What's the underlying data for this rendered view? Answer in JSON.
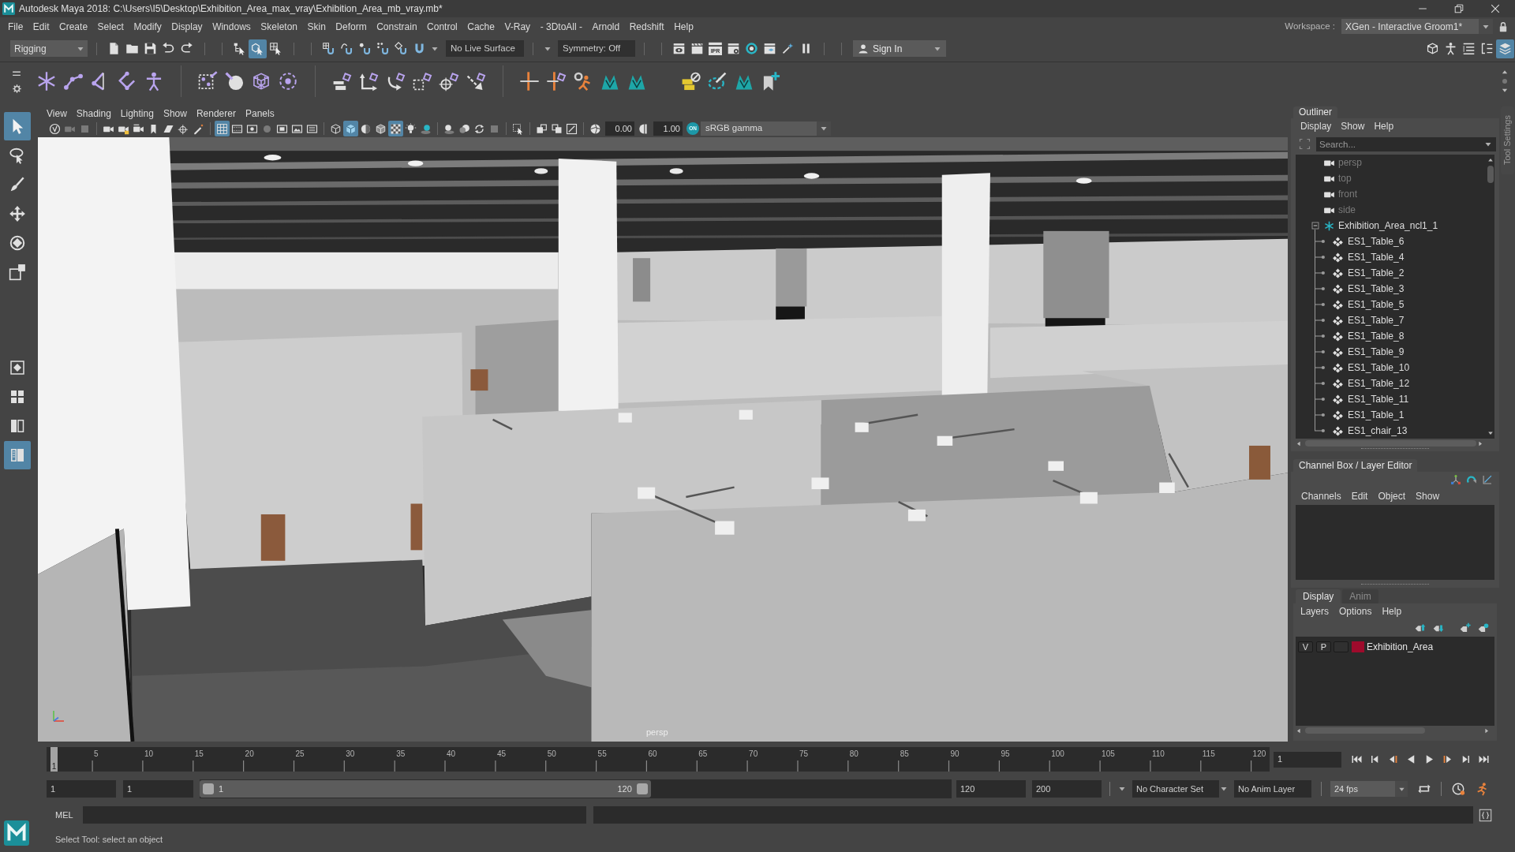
{
  "window": {
    "title": "Autodesk Maya 2018: C:\\Users\\I5\\Desktop\\Exhibition_Area_max_vray\\Exhibition_Area_mb_vray.mb*"
  },
  "menu_bar": [
    "File",
    "Edit",
    "Create",
    "Select",
    "Modify",
    "Display",
    "Windows",
    "Skeleton",
    "Skin",
    "Deform",
    "Constrain",
    "Control",
    "Cache",
    "V-Ray",
    "- 3DtoAll -",
    "Arnold",
    "Redshift",
    "Help"
  ],
  "workspace": {
    "label": "Workspace :",
    "value": "XGen - Interactive Groom1*"
  },
  "status_line": {
    "menu_set": "Rigging",
    "selection_buttons": [
      {
        "selected": false
      },
      {
        "selected": true
      },
      {
        "selected": false
      }
    ],
    "live_surface": "No Live Surface",
    "symmetry": "Symmetry: Off",
    "ipr_label": "IPR",
    "sign_in": "Sign In",
    "panel_buttons": [
      {
        "on": false
      },
      {
        "on": false
      },
      {
        "on": false
      },
      {
        "on": false
      },
      {
        "on": true
      }
    ]
  },
  "toolbox": {
    "tools": [
      {
        "selected": true
      },
      {
        "selected": false
      },
      {
        "selected": false
      },
      {
        "selected": false
      },
      {
        "selected": false
      },
      {
        "selected": false
      }
    ],
    "layouts": [
      {
        "selected": false
      },
      {
        "selected": false
      },
      {
        "selected": false
      },
      {
        "selected": true
      }
    ]
  },
  "viewport": {
    "menus": [
      "View",
      "Shading",
      "Lighting",
      "Show",
      "Renderer",
      "Panels"
    ],
    "toolbar_buttons": [
      {
        "on": false,
        "disabled": false
      },
      {
        "on": false,
        "disabled": true
      },
      {
        "on": false,
        "disabled": true
      },
      {
        "on": false,
        "disabled": false
      },
      {
        "on": false,
        "disabled": false
      },
      {
        "on": false,
        "disabled": false
      },
      {
        "on": false,
        "disabled": false
      },
      {
        "on": false,
        "disabled": false
      },
      {
        "on": false,
        "disabled": false
      },
      {
        "on": false,
        "disabled": false
      },
      {
        "on": true,
        "disabled": false
      },
      {
        "on": false,
        "disabled": false
      },
      {
        "on": false,
        "disabled": false
      },
      {
        "on": false,
        "disabled": true
      },
      {
        "on": false,
        "disabled": false
      },
      {
        "on": false,
        "disabled": false
      },
      {
        "on": false,
        "disabled": false
      },
      {
        "on": false,
        "disabled": false
      },
      {
        "on": true,
        "disabled": false
      },
      {
        "on": false,
        "disabled": false
      },
      {
        "on": false,
        "disabled": false
      },
      {
        "on": true,
        "disabled": false
      },
      {
        "on": false,
        "disabled": false
      },
      {
        "on": false,
        "disabled": false
      },
      {
        "on": false,
        "disabled": false
      },
      {
        "on": false,
        "disabled": false
      },
      {
        "on": false,
        "disabled": false
      },
      {
        "on": false,
        "disabled": true
      },
      {
        "on": false,
        "disabled": false
      },
      {
        "on": false,
        "disabled": false
      },
      {
        "on": false,
        "disabled": false
      },
      {
        "on": false,
        "disabled": false
      },
      {
        "on": false,
        "disabled": false
      },
      {
        "on": false,
        "disabled": false
      }
    ],
    "exposure": "0.00",
    "gamma": "1.00",
    "color_management": {
      "label": "ON",
      "on": true
    },
    "color_space": "sRGB gamma",
    "camera": "persp"
  },
  "outliner": {
    "title": "Outliner",
    "menus": [
      "Display",
      "Show",
      "Help"
    ],
    "search": {
      "placeholder": "Search..."
    },
    "items": [
      {
        "kind": "camera",
        "label": "persp",
        "dimmed": true,
        "selected": false
      },
      {
        "kind": "camera",
        "label": "top",
        "dimmed": true,
        "selected": false
      },
      {
        "kind": "camera",
        "label": "front",
        "dimmed": true,
        "selected": false
      },
      {
        "kind": "camera",
        "label": "side",
        "dimmed": true,
        "selected": false
      },
      {
        "kind": "group",
        "label": "Exhibition_Area_ncl1_1",
        "dimmed": false,
        "selected": false,
        "expanded": true,
        "children": [
          {
            "kind": "mesh",
            "label": "ES1_Table_6",
            "dimmed": false,
            "selected": false
          },
          {
            "kind": "mesh",
            "label": "ES1_Table_4",
            "dimmed": false,
            "selected": false
          },
          {
            "kind": "mesh",
            "label": "ES1_Table_2",
            "dimmed": false,
            "selected": false
          },
          {
            "kind": "mesh",
            "label": "ES1_Table_3",
            "dimmed": false,
            "selected": false
          },
          {
            "kind": "mesh",
            "label": "ES1_Table_5",
            "dimmed": false,
            "selected": false
          },
          {
            "kind": "mesh",
            "label": "ES1_Table_7",
            "dimmed": false,
            "selected": false
          },
          {
            "kind": "mesh",
            "label": "ES1_Table_8",
            "dimmed": false,
            "selected": false
          },
          {
            "kind": "mesh",
            "label": "ES1_Table_9",
            "dimmed": false,
            "selected": false
          },
          {
            "kind": "mesh",
            "label": "ES1_Table_10",
            "dimmed": false,
            "selected": false
          },
          {
            "kind": "mesh",
            "label": "ES1_Table_12",
            "dimmed": false,
            "selected": false
          },
          {
            "kind": "mesh",
            "label": "ES1_Table_11",
            "dimmed": false,
            "selected": false
          },
          {
            "kind": "mesh",
            "label": "ES1_Table_1",
            "dimmed": false,
            "selected": false
          },
          {
            "kind": "mesh",
            "label": "ES1_chair_13",
            "dimmed": false,
            "selected": false
          }
        ]
      }
    ]
  },
  "tool_settings_tab": "Tool Settings",
  "channel_box": {
    "title": "Channel Box / Layer Editor",
    "menus": [
      "Channels",
      "Edit",
      "Object",
      "Show"
    ]
  },
  "layer_editor": {
    "tabs": [
      {
        "label": "Display",
        "selected": true
      },
      {
        "label": "Anim",
        "selected": false
      }
    ],
    "menus": [
      "Layers",
      "Options",
      "Help"
    ],
    "layers": [
      {
        "visibility": "V",
        "playback": "P",
        "name": "Exhibition_Area",
        "color": "#9e0b2c"
      }
    ]
  },
  "time_slider": {
    "ticks": [
      "5",
      "10",
      "15",
      "20",
      "25",
      "30",
      "35",
      "40",
      "45",
      "50",
      "55",
      "60",
      "65",
      "70",
      "75",
      "80",
      "85",
      "90",
      "95",
      "100",
      "105",
      "110",
      "115",
      "120"
    ],
    "playhead_frame": "1",
    "level": 0,
    "current_frame": "1"
  },
  "range_slider": {
    "animation_start": "1",
    "playback_start": "1",
    "range_start_label": "1",
    "range_end_label": "120",
    "level": 0.6,
    "playback_end": "120",
    "animation_end": "200"
  },
  "time_controls": {
    "character_set": "No Character Set",
    "anim_layer": "No Anim Layer",
    "fps": "24 fps"
  },
  "command_line": {
    "language": "MEL"
  },
  "help_line": {
    "text": "Select Tool: select an object"
  }
}
